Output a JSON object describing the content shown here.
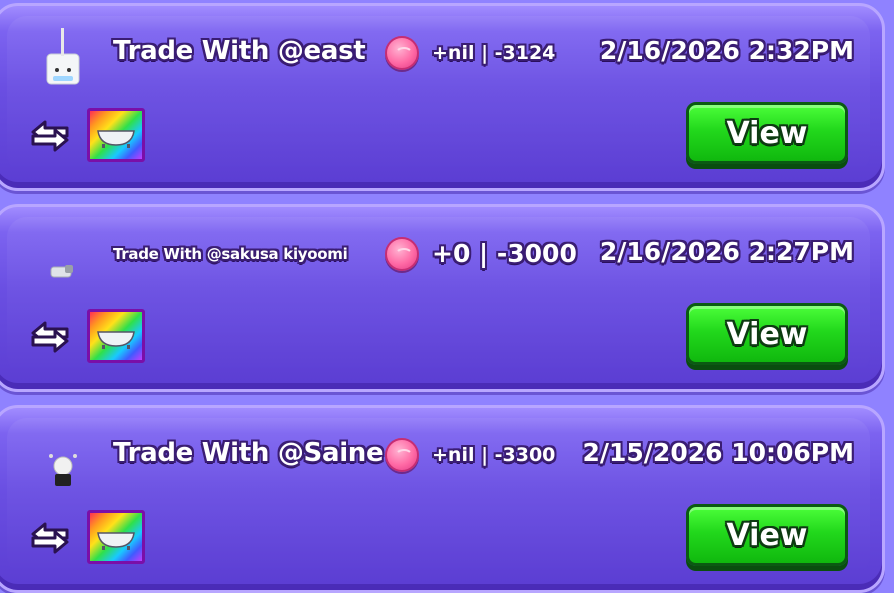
{
  "trades": [
    {
      "title": "Trade With @east",
      "amount": "+nil | -3124",
      "timestamp": "2/16/2026 2:32PM",
      "view_label": "View",
      "avatar_icon": "white-robot-avatar-icon",
      "item_icon": "rainbow-bathtub-item-icon"
    },
    {
      "title": "Trade With @sakusa kiyoomi",
      "amount": "+0 | -3000",
      "timestamp": "2/16/2026 2:27PM",
      "view_label": "View",
      "avatar_icon": "small-avatar-icon",
      "item_icon": "rainbow-bathtub-item-icon"
    },
    {
      "title": "Trade With @Saine",
      "amount": "+nil | -3300",
      "timestamp": "2/15/2026 10:06PM",
      "view_label": "View",
      "avatar_icon": "black-white-avatar-icon",
      "item_icon": "rainbow-bathtub-item-icon"
    }
  ],
  "colors": {
    "card": "#6a4fe2",
    "button": "#22d81c",
    "coin": "#ff6aa5",
    "text_outline": "#3a1d73"
  }
}
